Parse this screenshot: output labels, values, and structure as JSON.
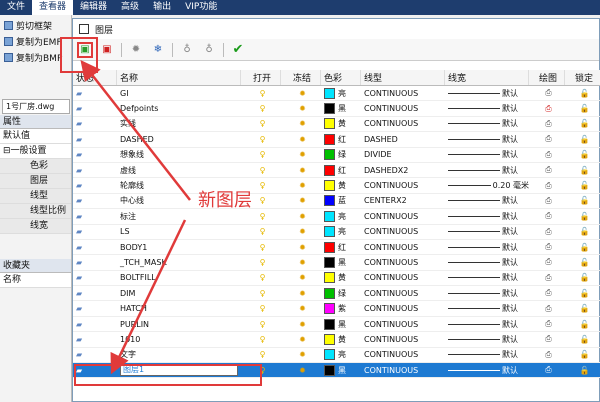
{
  "menubar": [
    "文件",
    "查看器",
    "编辑器",
    "高级",
    "输出",
    "VIP功能"
  ],
  "left_panel": {
    "buttons": [
      "剪切框架",
      "复制为EMF",
      "复制为BMP"
    ],
    "file_tab": "1号厂房.dwg",
    "props_header": "属性",
    "default_label": "默认值",
    "group": "⊟一般设置",
    "props": [
      "色彩",
      "图层",
      "线型",
      "线型比例",
      "线宽"
    ],
    "fav_header": "收藏夹",
    "fav_name": "名称"
  },
  "dialog": {
    "title": "图层",
    "columns": [
      "状态",
      "名称",
      "打开",
      "冻结",
      "色彩",
      "线型",
      "线宽",
      "绘图",
      "锁定"
    ],
    "callout": "新图层",
    "rows": [
      {
        "name": "GI",
        "color": "#00e5ff",
        "cname": "亮",
        "ltype": "CONTINUOUS",
        "lw": "默认"
      },
      {
        "name": "Defpoints",
        "color": "#000000",
        "cname": "黑",
        "ltype": "CONTINUOUS",
        "lw": "默认"
      },
      {
        "name": "实线",
        "color": "#ffff00",
        "cname": "黄",
        "ltype": "CONTINUOUS",
        "lw": "默认"
      },
      {
        "name": "DASHED",
        "color": "#ff0000",
        "cname": "红",
        "ltype": "DASHED",
        "lw": "默认"
      },
      {
        "name": "想象线",
        "color": "#00c000",
        "cname": "绿",
        "ltype": "DIVIDE",
        "lw": "默认"
      },
      {
        "name": "虚线",
        "color": "#ff0000",
        "cname": "红",
        "ltype": "DASHEDX2",
        "lw": "默认"
      },
      {
        "name": "轮廓线",
        "color": "#ffff00",
        "cname": "黄",
        "ltype": "CONTINUOUS",
        "lw": "0.20 毫米"
      },
      {
        "name": "中心线",
        "color": "#0000ff",
        "cname": "蓝",
        "ltype": "CENTERX2",
        "lw": "默认"
      },
      {
        "name": "标注",
        "color": "#00e5ff",
        "cname": "亮",
        "ltype": "CONTINUOUS",
        "lw": "默认"
      },
      {
        "name": "LS",
        "color": "#00e5ff",
        "cname": "亮",
        "ltype": "CONTINUOUS",
        "lw": "默认"
      },
      {
        "name": "BODY1",
        "color": "#ff0000",
        "cname": "红",
        "ltype": "CONTINUOUS",
        "lw": "默认"
      },
      {
        "name": "_TCH_MASK",
        "color": "#000000",
        "cname": "黑",
        "ltype": "CONTINUOUS",
        "lw": "默认"
      },
      {
        "name": "BOLTFILL",
        "color": "#ffff00",
        "cname": "黄",
        "ltype": "CONTINUOUS",
        "lw": "默认"
      },
      {
        "name": "DIM",
        "color": "#00c000",
        "cname": "绿",
        "ltype": "CONTINUOUS",
        "lw": "默认"
      },
      {
        "name": "HATCH",
        "color": "#ff00ff",
        "cname": "紫",
        "ltype": "CONTINUOUS",
        "lw": "默认"
      },
      {
        "name": "PURLIN",
        "color": "#000000",
        "cname": "黑",
        "ltype": "CONTINUOUS",
        "lw": "默认"
      },
      {
        "name": "1010",
        "color": "#ffff00",
        "cname": "黄",
        "ltype": "CONTINUOUS",
        "lw": "默认"
      },
      {
        "name": "文字",
        "color": "#00e5ff",
        "cname": "亮",
        "ltype": "CONTINUOUS",
        "lw": "默认"
      }
    ],
    "new_row": {
      "name": "图层1",
      "color": "#000000",
      "cname": "黑",
      "ltype": "CONTINUOUS",
      "lw": "默认"
    }
  }
}
